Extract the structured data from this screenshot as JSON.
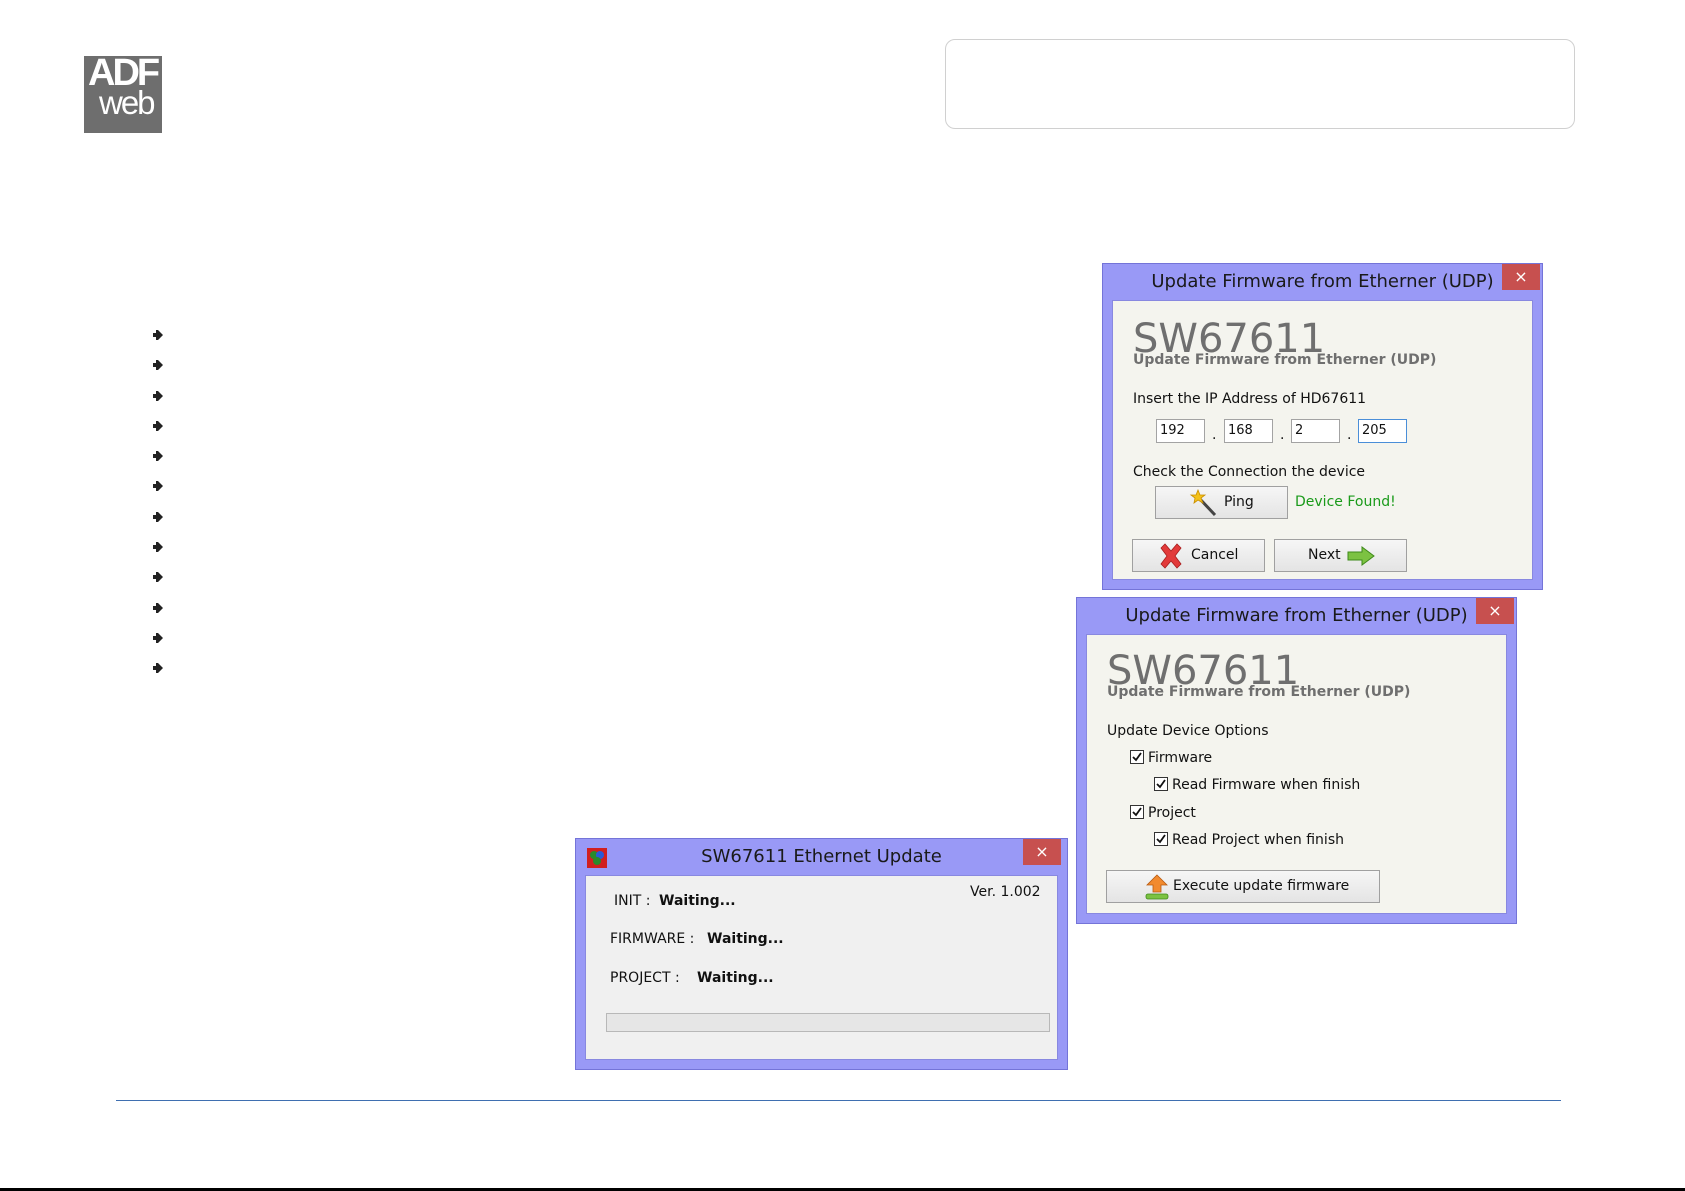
{
  "logo": {
    "line1": "ADF",
    "line2": "web"
  },
  "bullet_count": 12,
  "win1": {
    "title": "Update Firmware from Etherner (UDP)",
    "close": "×",
    "app_name": "SW67611",
    "subtitle": "Update Firmware from Etherner (UDP)",
    "ip_label": "Insert the IP Address of HD67611",
    "ip": [
      "192",
      "168",
      "2",
      "205"
    ],
    "ip_sep": ".",
    "check_label": "Check the Connection the device",
    "ping_label": "Ping",
    "status": "Device Found!",
    "cancel_label": "Cancel",
    "next_label": "Next"
  },
  "win2": {
    "title": "Update Firmware from Etherner (UDP)",
    "close": "×",
    "app_name": "SW67611",
    "subtitle": "Update Firmware from Etherner (UDP)",
    "options_label": "Update Device Options",
    "options": [
      {
        "label": "Firmware",
        "checked": true
      },
      {
        "label": "Read Firmware when finish",
        "checked": true
      },
      {
        "label": "Project",
        "checked": true
      },
      {
        "label": "Read Project when finish",
        "checked": true
      }
    ],
    "execute_label": "Execute update firmware"
  },
  "win3": {
    "title": "SW67611 Ethernet Update",
    "close": "×",
    "version": "Ver. 1.002",
    "rows": [
      {
        "label": "INIT :",
        "value": "Waiting..."
      },
      {
        "label": "FIRMWARE :",
        "value": "Waiting..."
      },
      {
        "label": "PROJECT :",
        "value": "Waiting..."
      }
    ],
    "progress": 0
  },
  "colors": {
    "title_bar": "#9999f6",
    "close_button": "#c7504f",
    "status_ok": "#1a9a1a",
    "rule": "#3f6fb0"
  },
  "icons": {
    "ping": "magic-wand-icon",
    "cancel": "red-x-icon",
    "next": "green-arrow-icon",
    "execute": "upload-arrow-icon",
    "app": "app-icon"
  }
}
